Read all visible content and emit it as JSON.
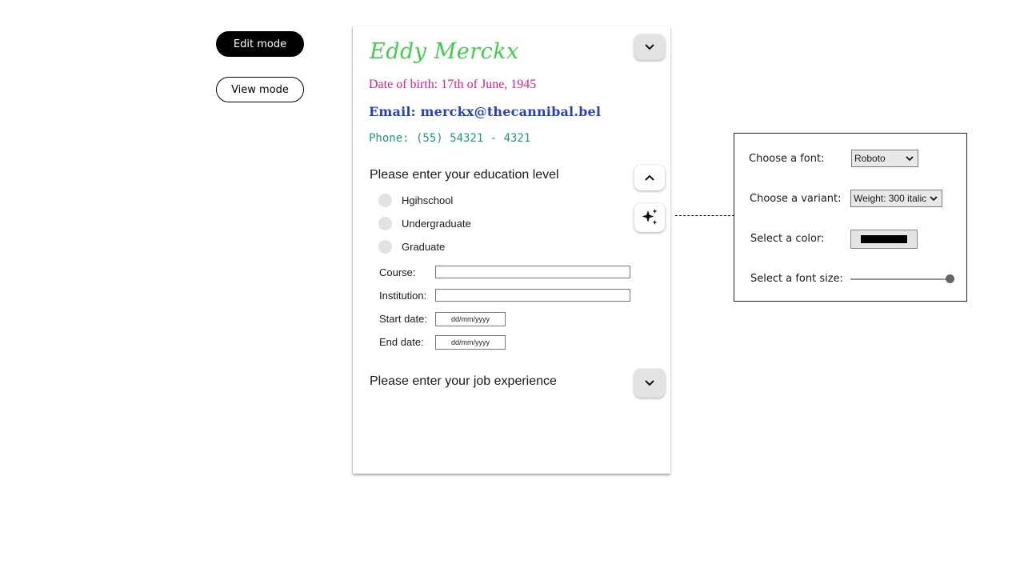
{
  "modes": {
    "edit_label": "Edit mode",
    "view_label": "View mode"
  },
  "profile": {
    "name": "Eddy Merckx",
    "dob": "Date of birth: 17th of June, 1945",
    "email": "Email: merckx@thecannibal.bel",
    "phone": "Phone: (55) 54321 - 4321"
  },
  "education": {
    "title": "Please enter your education level",
    "options": [
      "Hgihschool",
      "Undergraduate",
      "Graduate"
    ],
    "fields": {
      "course_label": "Course:",
      "institution_label": "Institution:",
      "start_label": "Start date:",
      "end_label": "End date:",
      "start_placeholder": "dd/mm/yyyy",
      "end_placeholder": "dd/mm/yyyy"
    }
  },
  "job": {
    "title": "Please enter your job experience"
  },
  "style_panel": {
    "font_label": "Choose a font:",
    "font_value": "Roboto",
    "variant_label": "Choose a variant:",
    "variant_value": "Weight: 300 italic",
    "color_label": "Select a color:",
    "color_value": "#000000",
    "size_label": "Select a font size:",
    "size_level": 1.0
  },
  "icons": {
    "collapse": "chevron-up-icon",
    "expand": "chevron-down-icon",
    "style": "sparkles-icon"
  }
}
